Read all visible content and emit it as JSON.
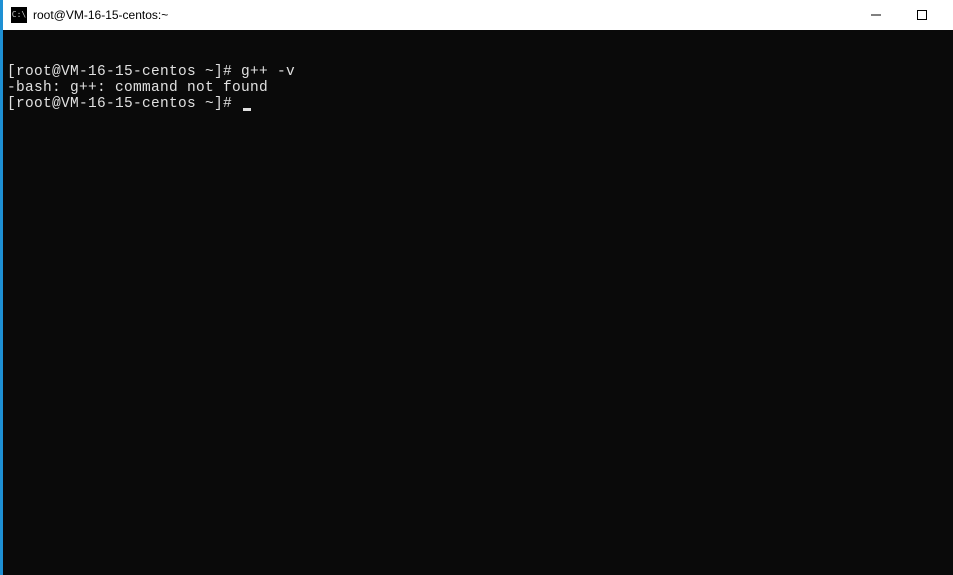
{
  "titlebar": {
    "icon_text": "C:\\",
    "title": "root@VM-16-15-centos:~"
  },
  "terminal": {
    "lines": [
      {
        "prompt": "[root@VM-16-15-centos ~]# ",
        "command": "g++ -v"
      },
      {
        "output": "-bash: g++: command not found"
      },
      {
        "prompt": "[root@VM-16-15-centos ~]# ",
        "command": "",
        "cursor": true
      }
    ]
  }
}
